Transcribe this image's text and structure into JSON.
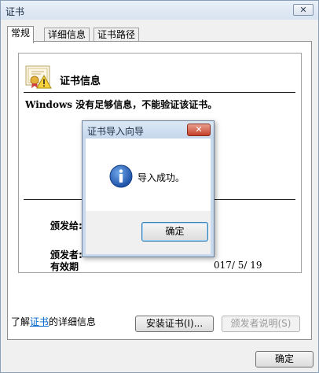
{
  "window": {
    "title": "证书",
    "close_glyph": "✕"
  },
  "tabs": [
    {
      "label": "常规"
    },
    {
      "label": "详细信息"
    },
    {
      "label": "证书路径"
    }
  ],
  "cert": {
    "info_title": "证书信息",
    "warning": "Windows 没有足够信息，不能验证该证书。",
    "issued_to_label": "颁发给:",
    "issued_by_label": "颁发者:",
    "valid_label": "有效期",
    "valid_to_partial": "017/  5/  19"
  },
  "buttons": {
    "install": "安装证书(I)...",
    "issuer_statement": "颁发者说明(S)",
    "ok": "确定"
  },
  "learn_more": {
    "prefix": "了解",
    "link": "证书",
    "suffix": "的详细信息"
  },
  "dialog": {
    "title": "证书导入向导",
    "close_glyph": "✕",
    "message": "导入成功。",
    "ok": "确定"
  }
}
